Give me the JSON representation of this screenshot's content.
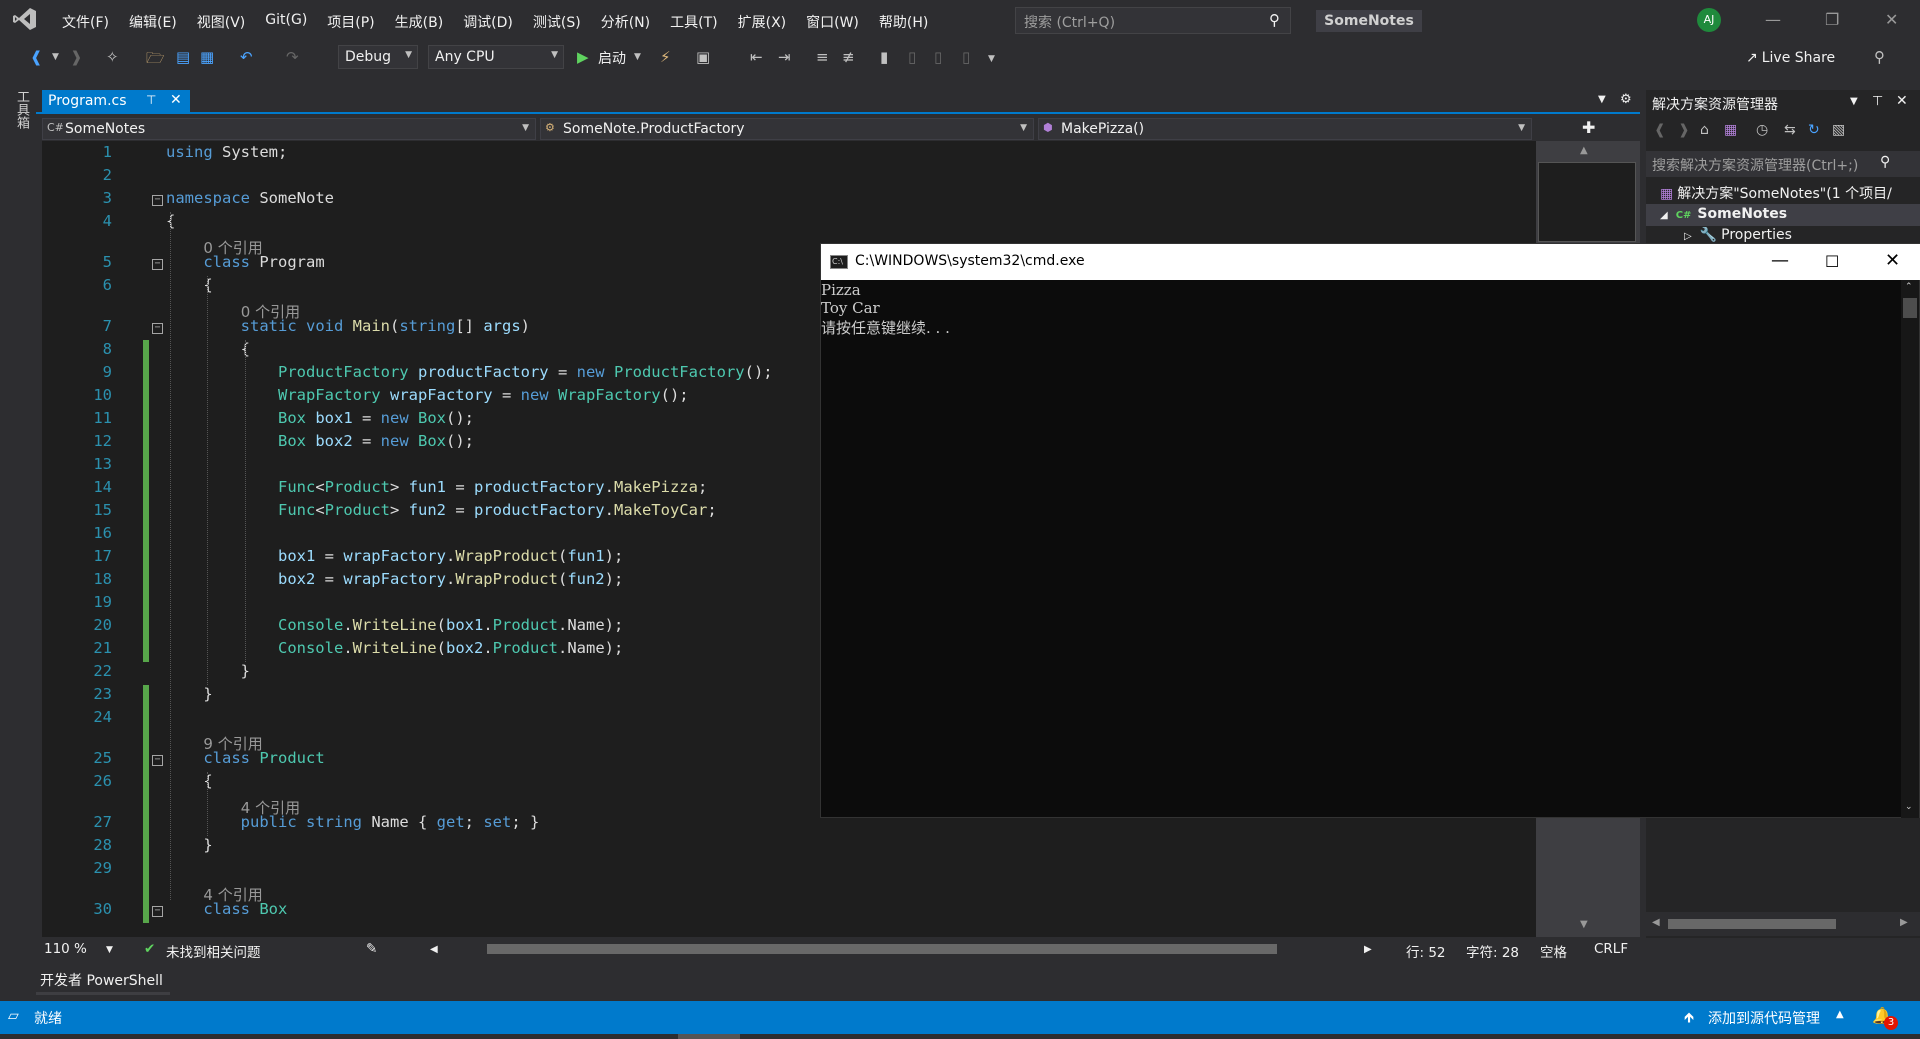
{
  "menubar": {
    "items": [
      "文件(F)",
      "编辑(E)",
      "视图(V)",
      "Git(G)",
      "项目(P)",
      "生成(B)",
      "调试(D)",
      "测试(S)",
      "分析(N)",
      "工具(T)",
      "扩展(X)",
      "窗口(W)",
      "帮助(H)"
    ],
    "search_placeholder": "搜索 (Ctrl+Q)",
    "solution_name": "SomeNotes",
    "user_initials": "AJ"
  },
  "toolbar": {
    "config": "Debug",
    "platform": "Any CPU",
    "start_label": "启动",
    "live_share": "Live Share"
  },
  "toolstrip": {
    "label": "工具箱"
  },
  "tabs": [
    {
      "label": "Program.cs"
    }
  ],
  "navbar": {
    "project": "SomeNotes",
    "class": "SomeNote.ProductFactory",
    "member": "MakePizza()"
  },
  "code": {
    "lines": [
      {
        "n": "1",
        "t": "using System;"
      },
      {
        "n": "2",
        "t": ""
      },
      {
        "n": "3",
        "t": "namespace SomeNote"
      },
      {
        "n": "4",
        "t": "{"
      },
      {
        "n": "5",
        "t": "    class Program",
        "lens": "0 个引用"
      },
      {
        "n": "6",
        "t": "    {"
      },
      {
        "n": "7",
        "t": "        static void Main(string[] args)",
        "lens": "0 个引用"
      },
      {
        "n": "8",
        "t": "        {"
      },
      {
        "n": "9",
        "t": "            ProductFactory productFactory = new ProductFactory();"
      },
      {
        "n": "10",
        "t": "            WrapFactory wrapFactory = new WrapFactory();"
      },
      {
        "n": "11",
        "t": "            Box box1 = new Box();"
      },
      {
        "n": "12",
        "t": "            Box box2 = new Box();"
      },
      {
        "n": "13",
        "t": ""
      },
      {
        "n": "14",
        "t": "            Func<Product> fun1 = productFactory.MakePizza;"
      },
      {
        "n": "15",
        "t": "            Func<Product> fun2 = productFactory.MakeToyCar;"
      },
      {
        "n": "16",
        "t": ""
      },
      {
        "n": "17",
        "t": "            box1 = wrapFactory.WrapProduct(fun1);"
      },
      {
        "n": "18",
        "t": "            box2 = wrapFactory.WrapProduct(fun2);"
      },
      {
        "n": "19",
        "t": ""
      },
      {
        "n": "20",
        "t": "            Console.WriteLine(box1.Product.Name);"
      },
      {
        "n": "21",
        "t": "            Console.WriteLine(box2.Product.Name);"
      },
      {
        "n": "22",
        "t": "        }"
      },
      {
        "n": "23",
        "t": "    }"
      },
      {
        "n": "24",
        "t": ""
      },
      {
        "n": "25",
        "t": "    class Product",
        "lens": "9 个引用"
      },
      {
        "n": "26",
        "t": "    {"
      },
      {
        "n": "27",
        "t": "        public string Name { get; set; }",
        "lens": "4 个引用"
      },
      {
        "n": "28",
        "t": "    }"
      },
      {
        "n": "29",
        "t": ""
      },
      {
        "n": "30",
        "t": "    class Box",
        "lens": "4 个引用"
      }
    ]
  },
  "editor_status": {
    "zoom": "110 %",
    "issues": "未找到相关问题",
    "line": "行: 52",
    "char": "字符: 28",
    "whitespace": "空格",
    "eol": "CRLF"
  },
  "solution_explorer": {
    "title": "解决方案资源管理器",
    "search_placeholder": "搜索解决方案资源管理器(Ctrl+;)",
    "solution_node": "解决方案\"SomeNotes\"(1 个项目/",
    "project_node": "SomeNotes",
    "properties_node": "Properties"
  },
  "cmd": {
    "title": "C:\\WINDOWS\\system32\\cmd.exe",
    "output": [
      "Pizza",
      "Toy Car",
      "请按任意键继续. . ."
    ]
  },
  "bottom": {
    "dev_powershell": "开发者 PowerShell",
    "status_ready": "就绪",
    "source_control": "添加到源代码管理",
    "notification_count": "3"
  }
}
